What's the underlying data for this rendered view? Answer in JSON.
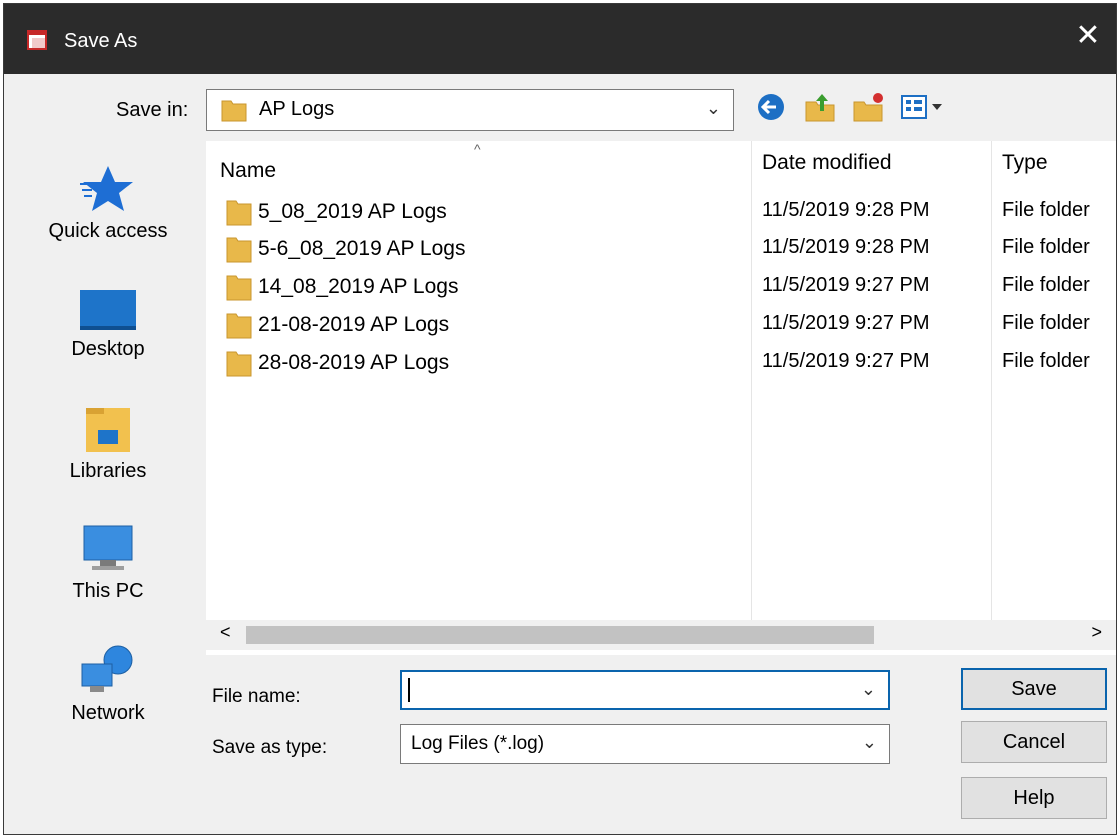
{
  "window": {
    "title": "Save As",
    "close_glyph": "✕"
  },
  "toolbar": {
    "save_in_label": "Save in:",
    "save_in_value": "AP Logs",
    "icons": [
      "back-icon",
      "up-folder-icon",
      "new-folder-icon",
      "view-menu-icon"
    ]
  },
  "sidebar": {
    "items": [
      {
        "label": "Quick access",
        "icon": "quick-access-star-icon"
      },
      {
        "label": "Desktop",
        "icon": "desktop-icon"
      },
      {
        "label": "Libraries",
        "icon": "libraries-icon"
      },
      {
        "label": "This PC",
        "icon": "this-pc-icon"
      },
      {
        "label": "Network",
        "icon": "network-icon"
      }
    ]
  },
  "list": {
    "columns": {
      "name": "Name",
      "date": "Date modified",
      "type": "Type"
    },
    "rows": [
      {
        "name": "5_08_2019 AP Logs",
        "date": "11/5/2019 9:28 PM",
        "type": "File folder"
      },
      {
        "name": "5-6_08_2019 AP Logs",
        "date": "11/5/2019 9:28 PM",
        "type": "File folder"
      },
      {
        "name": "14_08_2019 AP Logs",
        "date": "11/5/2019 9:27 PM",
        "type": "File folder"
      },
      {
        "name": "21-08-2019 AP Logs",
        "date": "11/5/2019 9:27 PM",
        "type": "File folder"
      },
      {
        "name": "28-08-2019 AP Logs",
        "date": "11/5/2019 9:27 PM",
        "type": "File folder"
      }
    ]
  },
  "scrollbar": {
    "left_glyph": "<",
    "right_glyph": ">"
  },
  "form": {
    "file_name_label": "File name:",
    "file_name_value": "",
    "save_type_label": "Save as type:",
    "save_type_value": "Log Files (*.log)"
  },
  "buttons": {
    "save": "Save",
    "cancel": "Cancel",
    "help": "Help"
  },
  "colors": {
    "titlebar": "#2b2b2b",
    "accent": "#0a64ad",
    "folder": "#e8b84a"
  }
}
